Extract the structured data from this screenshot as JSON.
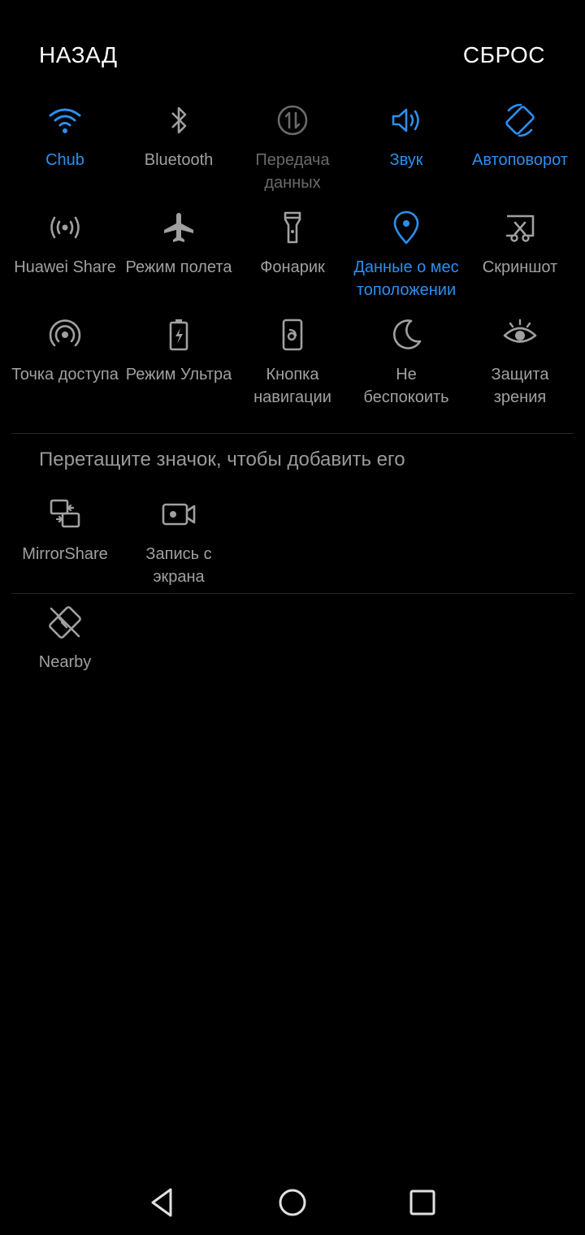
{
  "header": {
    "back_label": "НАЗАД",
    "reset_label": "СБРОС"
  },
  "colors": {
    "active": "#2d8ef0",
    "inactive": "#a0a0a0",
    "disabled": "#6a6a6a",
    "background": "#000000"
  },
  "active_tiles": [
    {
      "icon": "wifi-icon",
      "label": "Chub",
      "state": "on"
    },
    {
      "icon": "bluetooth-icon",
      "label": "Bluetooth",
      "state": "off"
    },
    {
      "icon": "mobile-data-icon",
      "label": "Передача\nданных",
      "state": "disabled"
    },
    {
      "icon": "sound-icon",
      "label": "Звук",
      "state": "on"
    },
    {
      "icon": "auto-rotate-icon",
      "label": "Автоповорот",
      "state": "on"
    },
    {
      "icon": "huawei-share-icon",
      "label": "Huawei Share",
      "state": "off"
    },
    {
      "icon": "airplane-icon",
      "label": "Режим полета",
      "state": "off"
    },
    {
      "icon": "flashlight-icon",
      "label": "Фонарик",
      "state": "off"
    },
    {
      "icon": "location-icon",
      "label": "Данные о мес\nтоположении",
      "state": "on"
    },
    {
      "icon": "screenshot-icon",
      "label": "Скриншот",
      "state": "off"
    },
    {
      "icon": "hotspot-icon",
      "label": "Точка доступа",
      "state": "off"
    },
    {
      "icon": "ultra-battery-icon",
      "label": "Режим Ультра",
      "state": "off"
    },
    {
      "icon": "navigation-button-icon",
      "label": "Кнопка\nнавигации",
      "state": "off"
    },
    {
      "icon": "do-not-disturb-icon",
      "label": "Не\nбеспокоить",
      "state": "off"
    },
    {
      "icon": "eye-comfort-icon",
      "label": "Защита\nзрения",
      "state": "off"
    }
  ],
  "hint_text": "Перетащите значок, чтобы добавить его",
  "available_tiles": [
    {
      "icon": "mirrorshare-icon",
      "label": "MirrorShare",
      "state": "off"
    },
    {
      "icon": "screen-record-icon",
      "label": "Запись с\nэкрана",
      "state": "off"
    }
  ],
  "extra_tiles": [
    {
      "icon": "nearby-icon",
      "label": "Nearby",
      "state": "off"
    }
  ],
  "navbar": {
    "back_icon": "back-triangle-icon",
    "home_icon": "home-circle-icon",
    "recents_icon": "recents-square-icon"
  }
}
